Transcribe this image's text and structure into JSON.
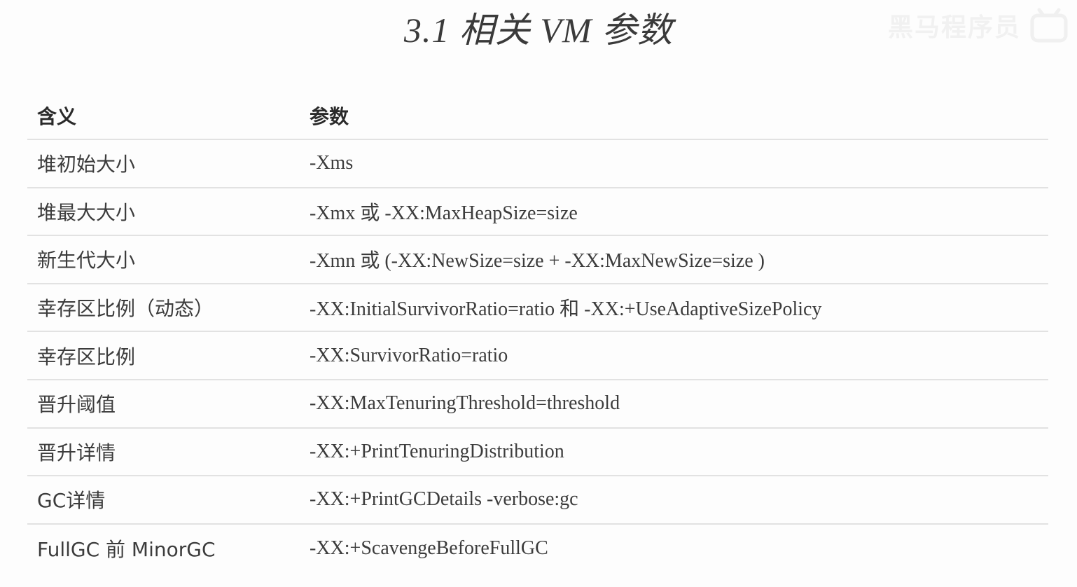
{
  "slide": {
    "title": "3.1 相关 VM 参数",
    "watermark_text": "黑马程序员",
    "watermark_logo": "bilibili-logo"
  },
  "table": {
    "headers": {
      "meaning": "含义",
      "param": "参数"
    },
    "rows": [
      {
        "meaning": "堆初始大小",
        "param": "-Xms"
      },
      {
        "meaning": "堆最大大小",
        "param": "-Xmx 或 -XX:MaxHeapSize=size"
      },
      {
        "meaning": "新生代大小",
        "param": "-Xmn 或 (-XX:NewSize=size + -XX:MaxNewSize=size )"
      },
      {
        "meaning": "幸存区比例（动态）",
        "param": "-XX:InitialSurvivorRatio=ratio 和 -XX:+UseAdaptiveSizePolicy"
      },
      {
        "meaning": "幸存区比例",
        "param": "-XX:SurvivorRatio=ratio"
      },
      {
        "meaning": "晋升阈值",
        "param": "-XX:MaxTenuringThreshold=threshold"
      },
      {
        "meaning": "晋升详情",
        "param": "-XX:+PrintTenuringDistribution"
      },
      {
        "meaning": "GC详情",
        "param": "-XX:+PrintGCDetails -verbose:gc"
      },
      {
        "meaning": "FullGC 前 MinorGC",
        "param": "-XX:+ScavengeBeforeFullGC"
      }
    ]
  }
}
